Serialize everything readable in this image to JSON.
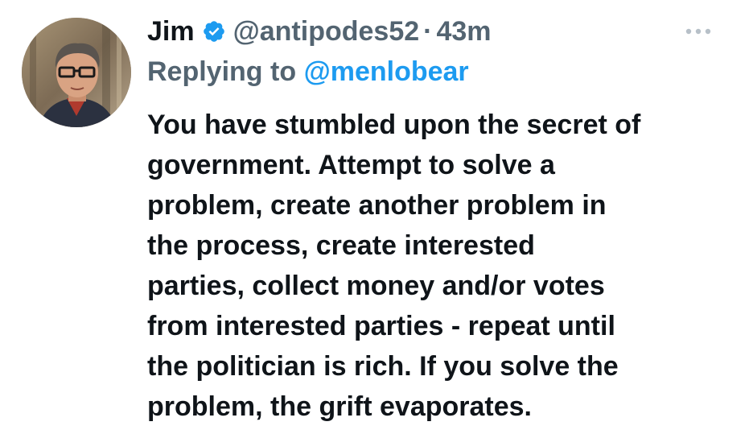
{
  "tweet": {
    "author_name": "Jim",
    "verified_icon": "verified-badge-icon",
    "handle": "@antipodes52",
    "separator": "·",
    "time": "43m",
    "more_icon": "more-options-icon",
    "replying_to_label": "Replying to",
    "replying_to_handle": "@menlobear",
    "body_lines": [
      "You have stumbled upon the secret of",
      "government. Attempt to solve a",
      "problem, create another problem in",
      "the process, create interested",
      "parties, collect money and/or votes",
      "from interested parties - repeat until",
      "the politician is rich. If you solve the",
      "problem, the grift evaporates."
    ]
  },
  "colors": {
    "text": "#0f1419",
    "secondary": "#536471",
    "link": "#1d9bf0",
    "verified": "#1d9bf0"
  }
}
